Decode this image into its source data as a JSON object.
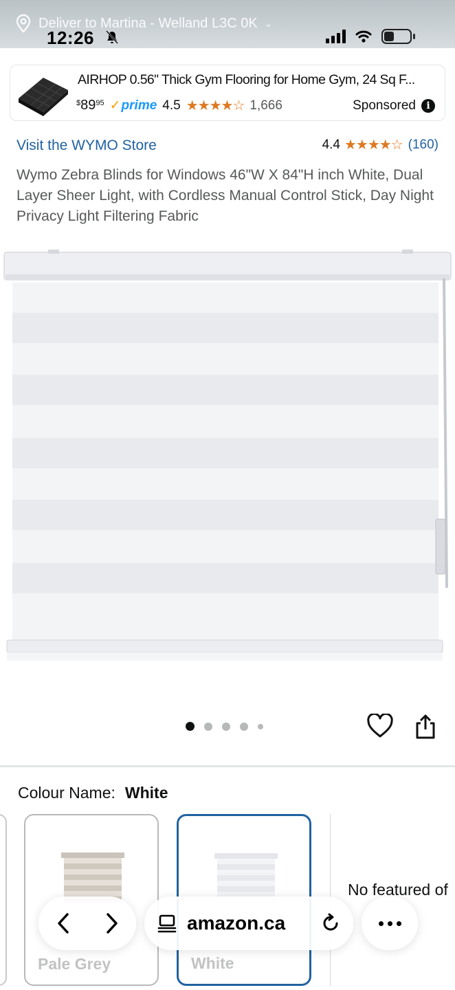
{
  "status_bar": {
    "delivery_text": "Deliver to Martina - Welland L3C 0K",
    "time": "12:26"
  },
  "ad": {
    "title": "AIRHOP 0.56\" Thick Gym Flooring for Home Gym, 24 Sq F...",
    "price_symbol": "$",
    "price_whole": "89",
    "price_cents": "95",
    "prime_label": "prime",
    "rating": "4.5",
    "stars": "★★★★☆",
    "review_count": "1,666",
    "sponsored_label": "Sponsored"
  },
  "product": {
    "store_link": "Visit the WYMO Store",
    "rating": "4.4",
    "stars": "★★★★☆",
    "review_count": "(160)",
    "title": "Wymo Zebra Blinds for Windows 46\"W X 84\"H inch White, Dual Layer Sheer Light, with Cordless Manual Control Stick, Day Night Privacy Light Filtering Fabric",
    "image_count": 5,
    "current_image": 1
  },
  "colour": {
    "label": "Colour Name:",
    "selected": "White",
    "swatches": [
      {
        "name": "Pale Grey",
        "selected": false
      },
      {
        "name": "White",
        "selected": true
      }
    ],
    "no_offer_text": "No featured of"
  },
  "browser": {
    "url": "amazon.ca"
  },
  "colors": {
    "link": "#2162a1",
    "star": "#de7921",
    "prime": "#1a98ff",
    "selected_border": "#2162a1"
  }
}
